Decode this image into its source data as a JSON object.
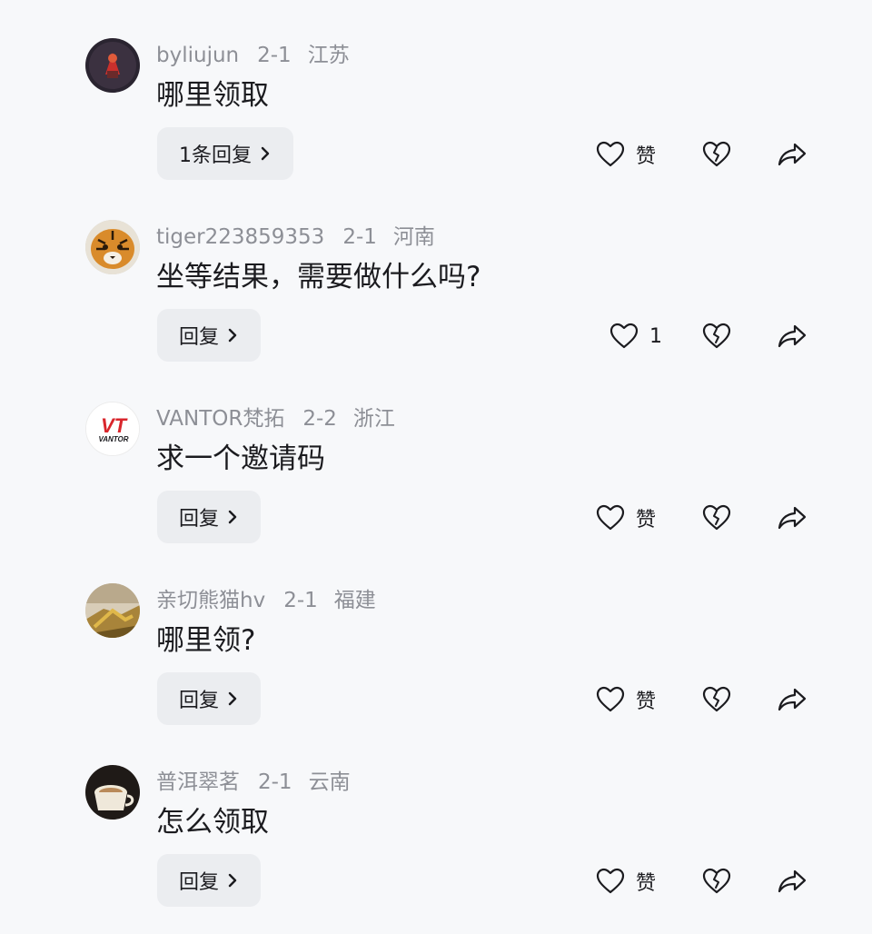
{
  "comments": [
    {
      "username": "byliujun",
      "date": "2-1",
      "location": "江苏",
      "text": "哪里领取",
      "reply_label": "1条回复",
      "like_label": "赞",
      "avatar_icon": "avatar-red-figure-dark"
    },
    {
      "username": "tiger223859353",
      "date": "2-1",
      "location": "河南",
      "text": "坐等结果，需要做什么吗?",
      "reply_label": "回复",
      "like_label": "1",
      "avatar_icon": "avatar-tiger"
    },
    {
      "username": "VANTOR梵拓",
      "date": "2-2",
      "location": "浙江",
      "text": "求一个邀请码",
      "reply_label": "回复",
      "like_label": "赞",
      "avatar_icon": "avatar-vantor-logo",
      "avatar_logo_text": "VT",
      "avatar_logo_sub": "VANTOR"
    },
    {
      "username": "亲切熊猫hv",
      "date": "2-1",
      "location": "福建",
      "text": "哪里领?",
      "reply_label": "回复",
      "like_label": "赞",
      "avatar_icon": "avatar-golden-landscape"
    },
    {
      "username": "普洱翠茗",
      "date": "2-1",
      "location": "云南",
      "text": "怎么领取",
      "reply_label": "回复",
      "like_label": "赞",
      "avatar_icon": "avatar-coffee-cup"
    }
  ],
  "icons": {
    "like": "heart-outline-icon",
    "dislike": "broken-heart-icon",
    "share": "share-arrow-icon",
    "reply_chevron": "chevron-right-icon"
  },
  "colors": {
    "background": "#f7f8fa",
    "meta_text": "#8d8f96",
    "reply_button_bg": "#ebedf0",
    "vantor_red": "#d9262c"
  }
}
